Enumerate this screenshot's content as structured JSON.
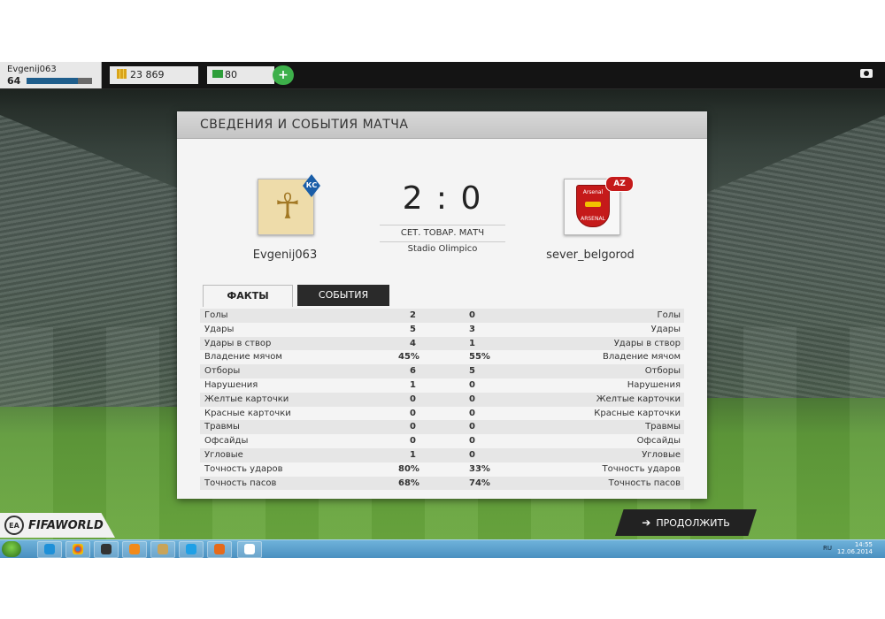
{
  "topbar": {
    "username": "Evgenij063",
    "level": "64",
    "xp_fraction": 0.78,
    "coins": "23 869",
    "points": "80",
    "add_label": "+"
  },
  "panel": {
    "title": "СВЕДЕНИЯ И СОБЫТИЯ МАТЧА",
    "home_team": "Evgenij063",
    "away_team": "sever_belgorod",
    "home_score": "2",
    "away_score": "0",
    "score_separator": ":",
    "match_type": "СЕТ. ТОВАР. МАТЧ",
    "stadium": "Stadio Olimpico",
    "home_badge_tag": "КС",
    "away_badge_tag": "AZ",
    "away_badge_text": "Arsenal",
    "away_badge_bottom": "ARSENAL"
  },
  "tabs": {
    "facts": "ФАКТЫ",
    "events": "СОБЫТИЯ"
  },
  "stats": [
    {
      "label": "Голы",
      "home": "2",
      "away": "0"
    },
    {
      "label": "Удары",
      "home": "5",
      "away": "3"
    },
    {
      "label": "Удары в створ",
      "home": "4",
      "away": "1"
    },
    {
      "label": "Владение мячом",
      "home": "45%",
      "away": "55%"
    },
    {
      "label": "Отборы",
      "home": "6",
      "away": "5"
    },
    {
      "label": "Нарушения",
      "home": "1",
      "away": "0"
    },
    {
      "label": "Желтые карточки",
      "home": "0",
      "away": "0"
    },
    {
      "label": "Красные карточки",
      "home": "0",
      "away": "0"
    },
    {
      "label": "Травмы",
      "home": "0",
      "away": "0"
    },
    {
      "label": "Офсайды",
      "home": "0",
      "away": "0"
    },
    {
      "label": "Угловые",
      "home": "1",
      "away": "0"
    },
    {
      "label": "Точность ударов",
      "home": "80%",
      "away": "33%"
    },
    {
      "label": "Точность пасов",
      "home": "68%",
      "away": "74%"
    }
  ],
  "footer": {
    "continue_label": "ПРОДОЛЖИТЬ",
    "brand": "FIFAWORLD",
    "ea_label": "EA"
  },
  "taskbar": {
    "lang": "RU",
    "time": "14:55",
    "date": "12.06.2014"
  },
  "colors": {
    "accent_green": "#3db04a",
    "xp_blue": "#1f5e8c",
    "tab_dark": "#2a2a2a"
  }
}
